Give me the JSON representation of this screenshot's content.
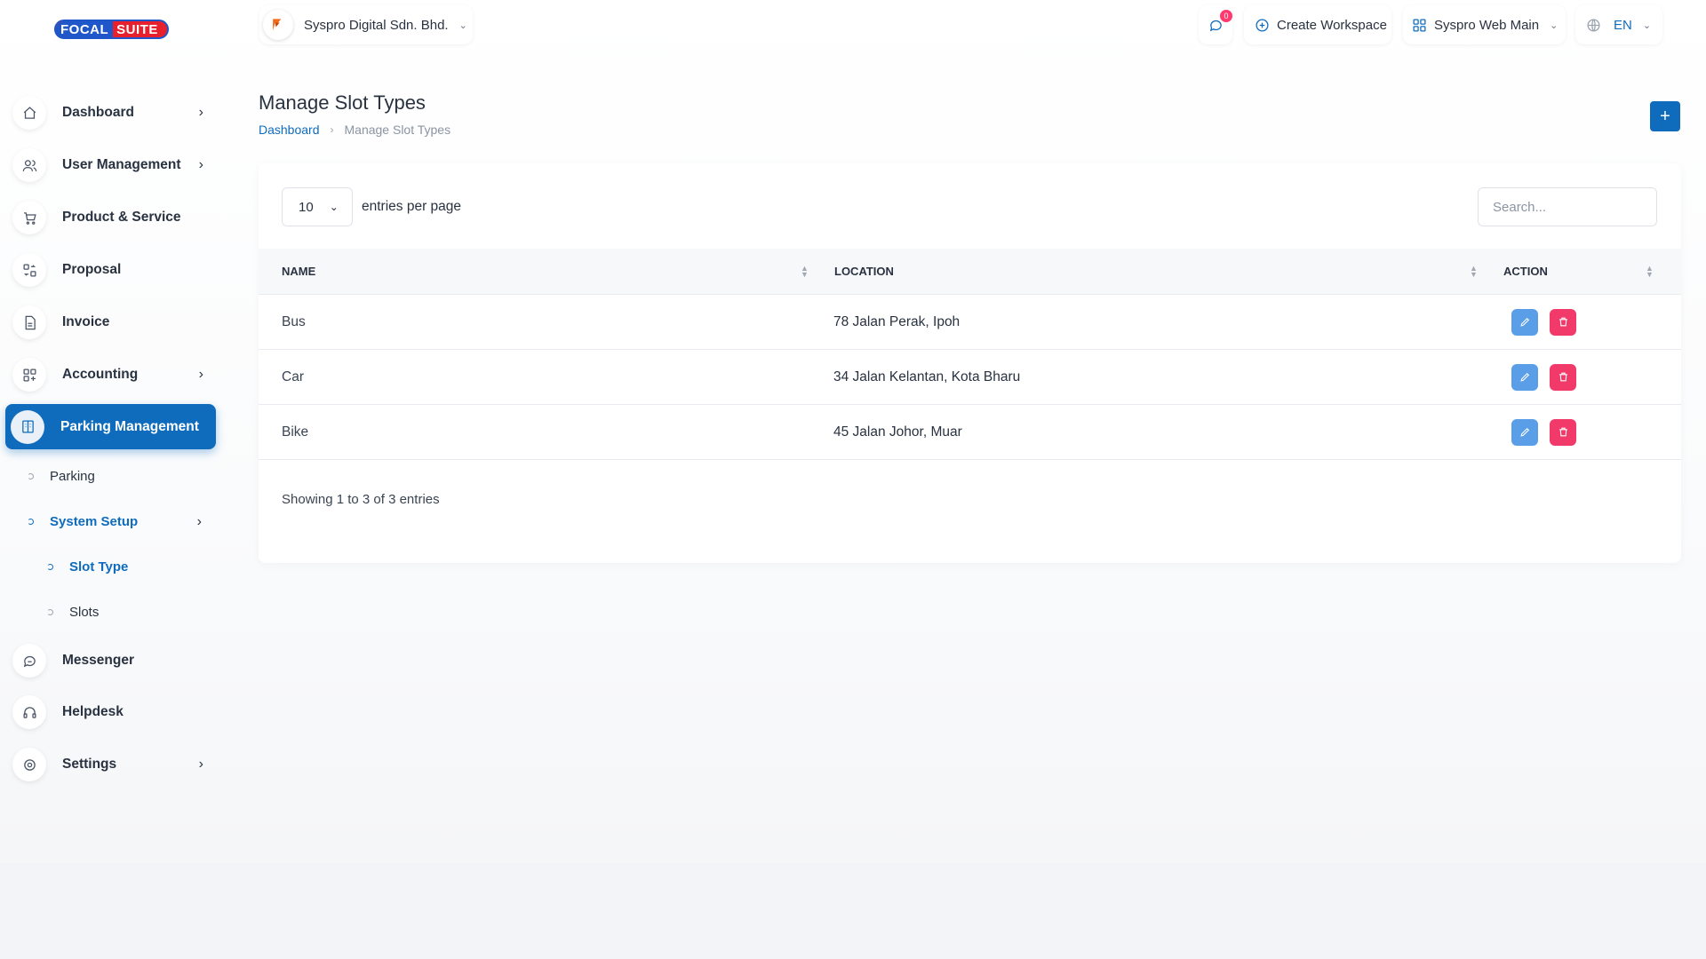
{
  "brand": {
    "part1": "FOCAL",
    "part2": "SUITE"
  },
  "sidebar": {
    "items": [
      {
        "label": "Dashboard",
        "icon": "home-icon",
        "has_chevron": true
      },
      {
        "label": "User Management",
        "icon": "users-icon",
        "has_chevron": true
      },
      {
        "label": "Product & Service",
        "icon": "cart-icon",
        "has_chevron": false
      },
      {
        "label": "Proposal",
        "icon": "proposal-icon",
        "has_chevron": false
      },
      {
        "label": "Invoice",
        "icon": "invoice-icon",
        "has_chevron": false
      },
      {
        "label": "Accounting",
        "icon": "accounting-icon",
        "has_chevron": true
      },
      {
        "label": "Parking Management",
        "icon": "parking-icon",
        "has_chevron": false,
        "active": true
      },
      {
        "label": "Messenger",
        "icon": "messenger-icon",
        "has_chevron": false
      },
      {
        "label": "Helpdesk",
        "icon": "headset-icon",
        "has_chevron": false
      },
      {
        "label": "Settings",
        "icon": "gear-icon",
        "has_chevron": true
      }
    ],
    "sub": {
      "parking": "Parking",
      "system_setup": "System Setup",
      "slot_type": "Slot Type",
      "slots": "Slots"
    }
  },
  "topbar": {
    "company": "Syspro Digital Sdn. Bhd.",
    "notification_count": "0",
    "create_workspace": "Create Workspace",
    "workspace": "Syspro Web Main",
    "language": "EN"
  },
  "page": {
    "title": "Manage Slot Types",
    "breadcrumb_home": "Dashboard",
    "breadcrumb_current": "Manage Slot Types",
    "add_label": "+"
  },
  "table": {
    "per_page": "10",
    "per_page_label": "entries per page",
    "search_placeholder": "Search...",
    "columns": [
      "Name",
      "Location",
      "Action"
    ],
    "rows": [
      {
        "name": "Bus",
        "location": "78 Jalan Perak, Ipoh"
      },
      {
        "name": "Car",
        "location": "34 Jalan Kelantan, Kota Bharu"
      },
      {
        "name": "Bike",
        "location": "45 Jalan Johor, Muar"
      }
    ],
    "footer": "Showing 1 to 3 of 3 entries"
  },
  "colors": {
    "primary": "#0f6cbd",
    "edit": "#5b9ee8",
    "delete": "#f23a6a",
    "badge": "#ff3a6e"
  }
}
